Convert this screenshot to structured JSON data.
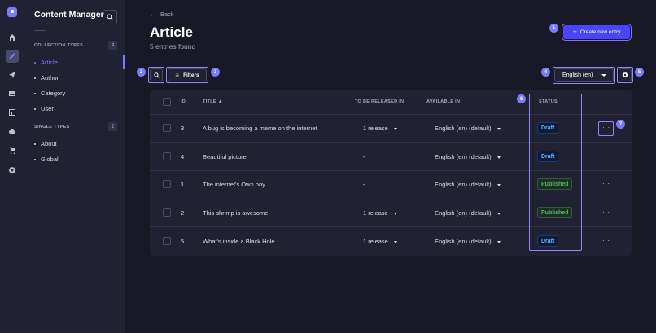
{
  "nav": {
    "title": "Content Manager",
    "collection_types_label": "COLLECTION TYPES",
    "collection_types_count": "4",
    "collection_items": [
      "Article",
      "Author",
      "Category",
      "User"
    ],
    "single_types_label": "SINGLE TYPES",
    "single_types_count": "2",
    "single_items": [
      "About",
      "Global"
    ],
    "active_item": "Article"
  },
  "header": {
    "back_label": "Back",
    "title": "Article",
    "subtitle": "5 entries found",
    "create_label": "Create new entry"
  },
  "toolbar": {
    "filters_label": "Filters",
    "locale": "English (en)"
  },
  "annotations": [
    "1",
    "2",
    "3",
    "4",
    "5",
    "6",
    "7"
  ],
  "table": {
    "headers": {
      "id": "ID",
      "title": "TITLE",
      "release": "TO BE RELEASED IN",
      "available": "AVAILABLE IN",
      "status": "STATUS"
    },
    "rows": [
      {
        "id": "3",
        "title": "A bug is becoming a meme on the internet",
        "release": "1 release",
        "release_dropdown": true,
        "available": "English (en) (default)",
        "status": "Draft",
        "more": "···"
      },
      {
        "id": "4",
        "title": "Beautiful picture",
        "release": "-",
        "release_dropdown": false,
        "available": "English (en) (default)",
        "status": "Draft",
        "more": "···"
      },
      {
        "id": "1",
        "title": "The internet's Own boy",
        "release": "-",
        "release_dropdown": false,
        "available": "English (en) (default)",
        "status": "Published",
        "more": "···"
      },
      {
        "id": "2",
        "title": "This shrimp is awesome",
        "release": "1 release",
        "release_dropdown": true,
        "available": "English (en) (default)",
        "status": "Published",
        "more": "···"
      },
      {
        "id": "5",
        "title": "What's inside a Black Hole",
        "release": "1 release",
        "release_dropdown": true,
        "available": "English (en) (default)",
        "status": "Draft",
        "more": "···"
      }
    ]
  },
  "colors": {
    "background": "#181826",
    "panel": "#212134",
    "accent": "#4945ff",
    "highlight": "#7b79ff",
    "draft": "#66b7f1",
    "published": "#5cb176"
  }
}
